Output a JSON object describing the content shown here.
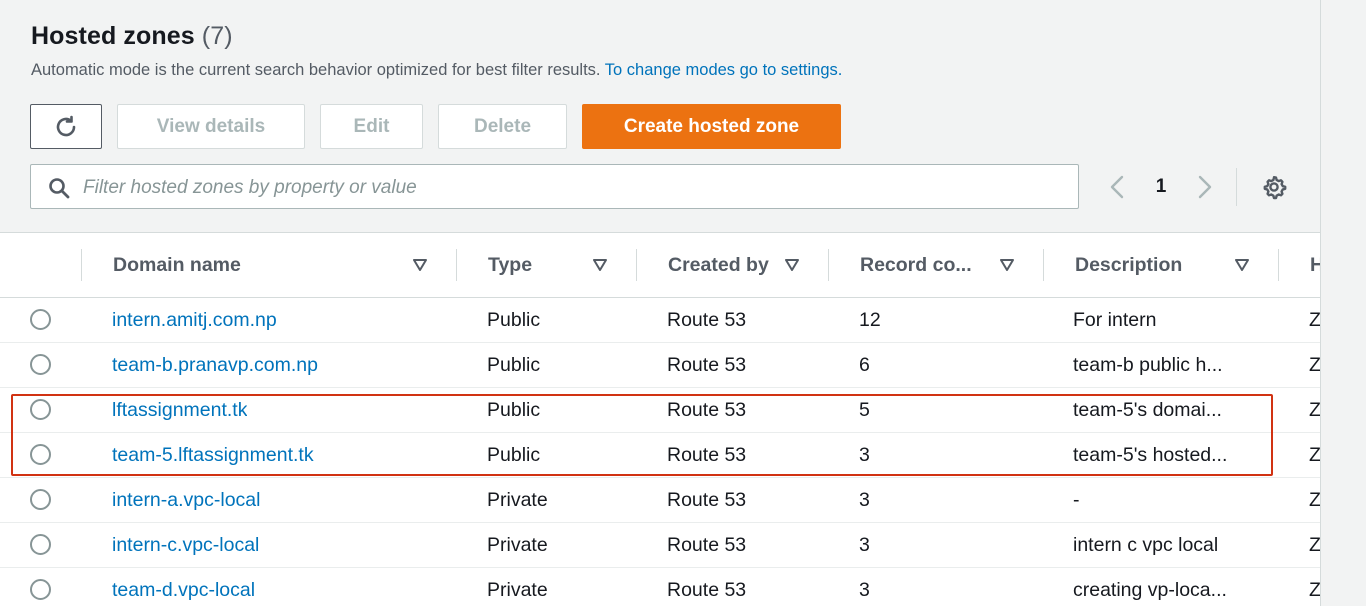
{
  "header": {
    "title": "Hosted zones",
    "count": "(7)",
    "subtitle": "Automatic mode is the current search behavior optimized for best filter results.",
    "subtitle_link": "To change modes go to settings."
  },
  "toolbar": {
    "refresh_icon": "refresh-icon",
    "view_details": "View details",
    "edit": "Edit",
    "delete": "Delete",
    "create": "Create hosted zone"
  },
  "search": {
    "placeholder": "Filter hosted zones by property or value"
  },
  "pagination": {
    "page": "1"
  },
  "table": {
    "columns": [
      "Domain name",
      "Type",
      "Created by",
      "Record co...",
      "Description",
      "H"
    ],
    "rows": [
      {
        "domain": "intern.amitj.com.np",
        "type": "Public",
        "created_by": "Route 53",
        "records": "12",
        "description": "For intern",
        "extra": "Z"
      },
      {
        "domain": "team-b.pranavp.com.np",
        "type": "Public",
        "created_by": "Route 53",
        "records": "6",
        "description": "team-b public h...",
        "extra": "Z"
      },
      {
        "domain": "lftassignment.tk",
        "type": "Public",
        "created_by": "Route 53",
        "records": "5",
        "description": "team-5's domai...",
        "extra": "Z"
      },
      {
        "domain": "team-5.lftassignment.tk",
        "type": "Public",
        "created_by": "Route 53",
        "records": "3",
        "description": "team-5's hosted...",
        "extra": "Z"
      },
      {
        "domain": "intern-a.vpc-local",
        "type": "Private",
        "created_by": "Route 53",
        "records": "3",
        "description": "-",
        "extra": "Z"
      },
      {
        "domain": "intern-c.vpc-local",
        "type": "Private",
        "created_by": "Route 53",
        "records": "3",
        "description": "intern c vpc local",
        "extra": "Z"
      },
      {
        "domain": "team-d.vpc-local",
        "type": "Private",
        "created_by": "Route 53",
        "records": "3",
        "description": "creating vp-loca...",
        "extra": "Z"
      }
    ]
  },
  "colors": {
    "primary": "#ec7211",
    "link": "#0073bb",
    "highlight": "#d13212"
  }
}
